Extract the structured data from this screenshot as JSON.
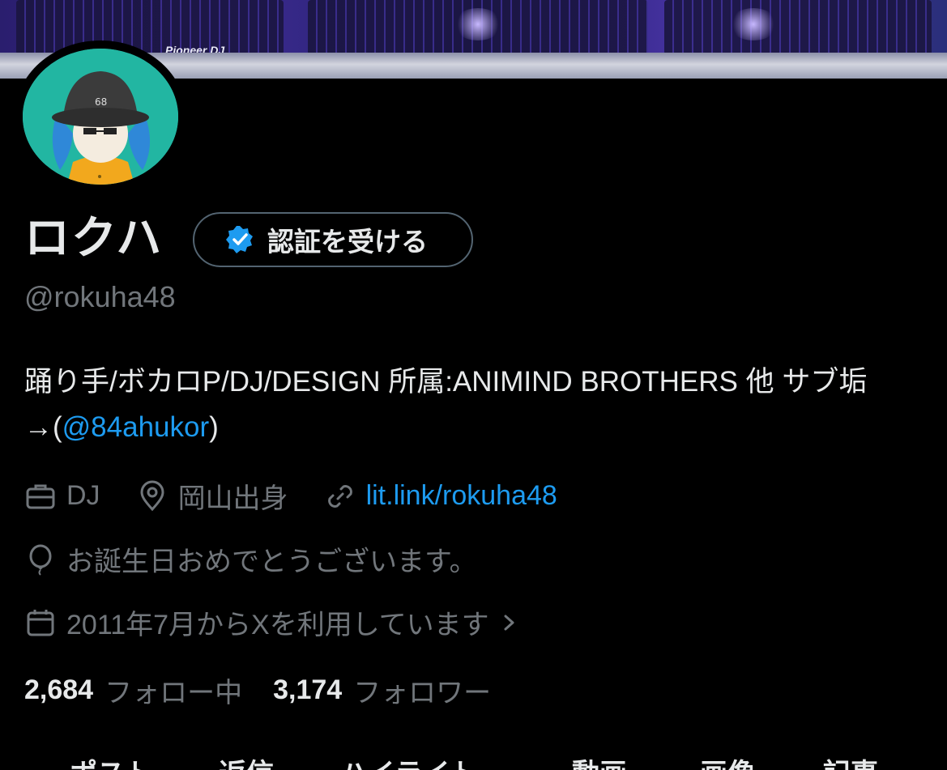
{
  "banner": {
    "brand_text": "Pioneer DJ"
  },
  "profile": {
    "display_name": "ロクハ",
    "verify_button_label": "認証を受ける",
    "handle": "@rokuha48",
    "bio_text": "踊り手/ボカロP/DJ/DESIGN 所属:ANIMIND BROTHERS 他 サブ垢→(",
    "bio_mention": "@84ahukor",
    "bio_suffix": ")",
    "job": "DJ",
    "location": "岡山出身",
    "website": "lit.link/rokuha48",
    "birthday_text": "お誕生日おめでとうございます。",
    "joined_text": "2011年7月からXを利用しています",
    "following_count": "2,684",
    "following_label": "フォロー中",
    "followers_count": "3,174",
    "followers_label": "フォロワー"
  },
  "tabs": [
    "ポスト",
    "返信",
    "ハイライト",
    "動画",
    "画像",
    "記事"
  ],
  "colors": {
    "accent": "#1d9bf0",
    "muted": "#71767b",
    "text": "#e7e9ea",
    "background": "#000000"
  }
}
